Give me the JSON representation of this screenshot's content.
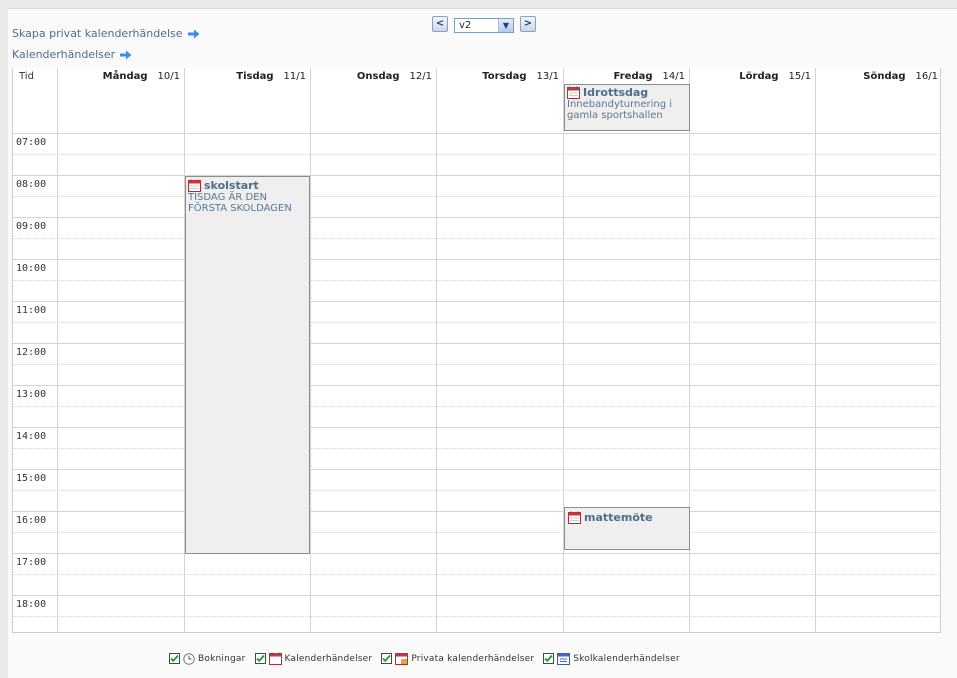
{
  "links": {
    "create_private": "Skapa privat kalenderhändelse",
    "calendar_events": "Kalenderhändelser"
  },
  "week_nav": {
    "prev_symbol": "<",
    "next_symbol": ">",
    "selected_week": "v2"
  },
  "grid": {
    "time_header": "Tid",
    "days": [
      {
        "name": "Måndag",
        "date": "10/1"
      },
      {
        "name": "Tisdag",
        "date": "11/1"
      },
      {
        "name": "Onsdag",
        "date": "12/1"
      },
      {
        "name": "Torsdag",
        "date": "13/1"
      },
      {
        "name": "Fredag",
        "date": "14/1"
      },
      {
        "name": "Lördag",
        "date": "15/1"
      },
      {
        "name": "Söndag",
        "date": "16/1"
      }
    ],
    "hours": [
      "07:00",
      "08:00",
      "09:00",
      "10:00",
      "11:00",
      "12:00",
      "13:00",
      "14:00",
      "15:00",
      "16:00",
      "17:00",
      "18:00"
    ]
  },
  "events": {
    "all_day_friday": {
      "title": "Idrottsdag",
      "description": "Innebandyturnering i gamla sportshallen"
    },
    "tuesday": {
      "title": "skolstart",
      "description": "TISDAG ÄR DEN FÖRSTA SKOLDAGEN"
    },
    "friday": {
      "title": "mattemöte"
    }
  },
  "legend": {
    "bookings": "Bokningar",
    "calendar_events": "Kalenderhändelser",
    "private_events": "Privata kalenderhändelser",
    "school_events": "Skolkalenderhändelser"
  },
  "colors": {
    "link": "#4e6e8e",
    "event_border": "#8d8d8d",
    "event_bg": "#efefef",
    "calendar_icon_red": "#c8353b"
  }
}
